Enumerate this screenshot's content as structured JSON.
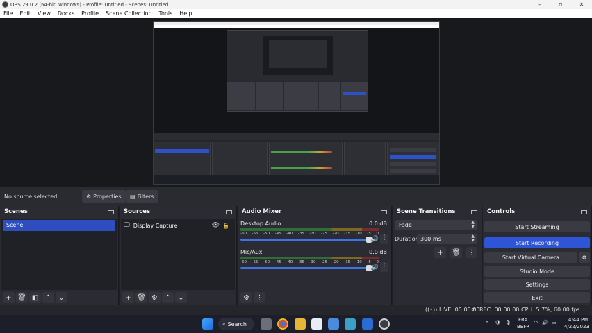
{
  "window": {
    "title": "OBS 29.0.2 (64-bit, windows) - Profile: Untitled - Scenes: Untitled",
    "minimize": "–",
    "maximize": "▫",
    "close": "✕"
  },
  "menu": [
    "File",
    "Edit",
    "View",
    "Docks",
    "Profile",
    "Scene Collection",
    "Tools",
    "Help"
  ],
  "source_toolbar": {
    "no_source": "No source selected",
    "properties": "Properties",
    "filters": "Filters"
  },
  "scenes": {
    "title": "Scenes",
    "items": [
      "Scene"
    ]
  },
  "sources": {
    "title": "Sources",
    "items": [
      "Display Capture"
    ]
  },
  "mixer": {
    "title": "Audio Mixer",
    "ticks": [
      "-60",
      "-55",
      "-50",
      "-45",
      "-40",
      "-35",
      "-30",
      "-25",
      "-20",
      "-15",
      "-10",
      "-5",
      "0"
    ],
    "channels": [
      {
        "name": "Desktop Audio",
        "db": "0.0 dB",
        "volume_fraction": 0.97
      },
      {
        "name": "Mic/Aux",
        "db": "0.0 dB",
        "volume_fraction": 0.97
      }
    ]
  },
  "transitions": {
    "title": "Scene Transitions",
    "selected": "Fade",
    "duration_label": "Duration",
    "duration_value": "300 ms"
  },
  "controls": {
    "title": "Controls",
    "start_streaming": "Start Streaming",
    "start_recording": "Start Recording",
    "start_virtual_camera": "Start Virtual Camera",
    "studio_mode": "Studio Mode",
    "settings": "Settings",
    "exit": "Exit"
  },
  "status": {
    "live": "LIVE: 00:00:00",
    "rec": "REC: 00:00:00",
    "cpu": "CPU: 5.7%, 60.00 fps"
  },
  "taskbar": {
    "search": "Search",
    "lang1": "FRA",
    "lang2": "BEFR",
    "time": "4:44 PM",
    "date": "4/22/2023"
  },
  "colors": {
    "accent": "#2e55d6",
    "panel": "#2b2c33",
    "selected": "#2e4dbf"
  }
}
